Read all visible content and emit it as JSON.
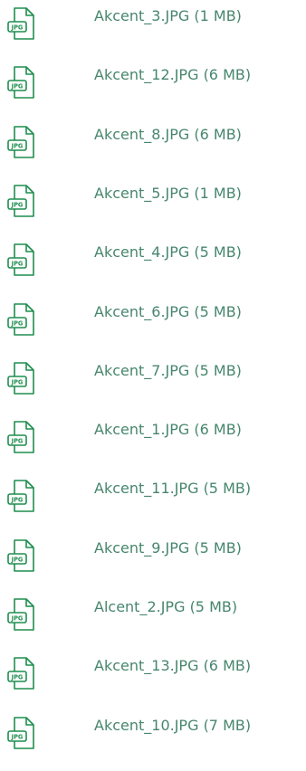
{
  "icon": {
    "name": "jpg-file-icon",
    "text": "JPG",
    "color": "#1f8e4f"
  },
  "text_color": "#47866e",
  "files": [
    {
      "label": "Akcent_3.JPG (1 MB)"
    },
    {
      "label": "Akcent_12.JPG (6 MB)"
    },
    {
      "label": "Akcent_8.JPG (6 MB)"
    },
    {
      "label": "Akcent_5.JPG (1 MB)"
    },
    {
      "label": "Akcent_4.JPG (5 MB)"
    },
    {
      "label": "Akcent_6.JPG (5 MB)"
    },
    {
      "label": "Akcent_7.JPG (5 MB)"
    },
    {
      "label": "Akcent_1.JPG (6 MB)"
    },
    {
      "label": "Akcent_11.JPG (5 MB)"
    },
    {
      "label": "Akcent_9.JPG (5 MB)"
    },
    {
      "label": "Alcent_2.JPG (5 MB)"
    },
    {
      "label": "Akcent_13.JPG (6 MB)"
    },
    {
      "label": "Akcent_10.JPG (7 MB)"
    }
  ]
}
